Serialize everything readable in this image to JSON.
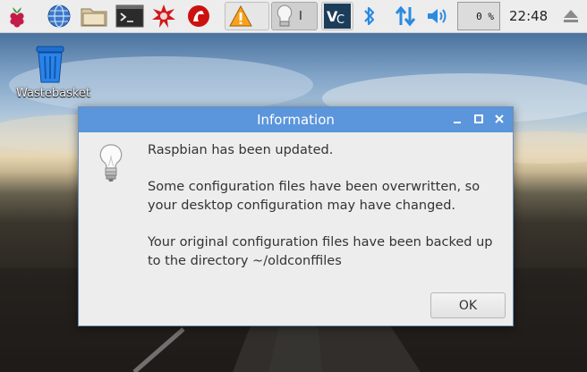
{
  "taskbar": {
    "launchers": [
      "raspberry-menu-icon",
      "web-browser-icon",
      "file-manager-icon",
      "terminal-icon",
      "wolfram-icon",
      "mathematica-icon"
    ],
    "tasks": [
      {
        "icon": "warning-icon",
        "label": ""
      },
      {
        "icon": "lightbulb-icon",
        "label": "I"
      },
      {
        "icon": "vnc-icon",
        "label": ""
      }
    ],
    "tray": {
      "cpu_text": "0 %",
      "clock": "22:48"
    }
  },
  "desktop": {
    "icons": [
      {
        "label": "Wastebasket"
      }
    ]
  },
  "dialog": {
    "title": "Information",
    "message_1": "Raspbian has been updated.",
    "message_2": "Some configuration files have been overwritten, so your desktop configuration may have changed.",
    "message_3": "Your original configuration files have been backed up to the directory ~/oldconffiles",
    "ok_label": "OK"
  }
}
